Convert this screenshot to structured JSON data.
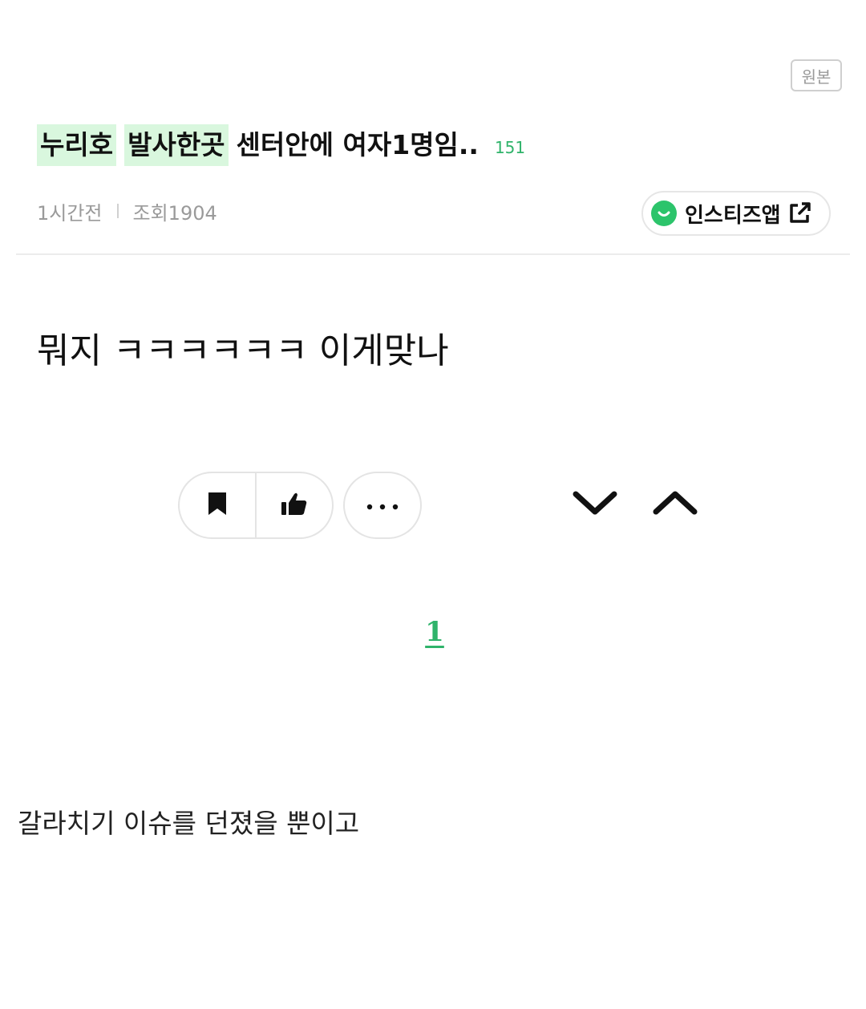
{
  "header": {
    "original_button_label": "원본"
  },
  "post": {
    "title_tag1": "누리호",
    "title_tag2": "발사한곳",
    "title_rest": "센터안에 여자1명임..",
    "comment_count": "151",
    "time": "1시간전",
    "views": "조회1904",
    "app_button_label": "인스티즈앱",
    "body": "뭐지 ㅋㅋㅋㅋㅋㅋ 이게맞나"
  },
  "actions": {
    "bookmark_icon": "bookmark-icon",
    "like_icon": "thumbs-up-icon",
    "more_icon": "more-dots-icon",
    "next_icon": "chevron-down-icon",
    "prev_icon": "chevron-up-icon"
  },
  "pagination": {
    "current_page": "1"
  },
  "comment": {
    "text": "갈라치기 이슈를 던졌을 뿐이고"
  },
  "colors": {
    "accent": "#2fb36a",
    "highlight": "#d9f7de",
    "logo": "#2cc46b"
  }
}
